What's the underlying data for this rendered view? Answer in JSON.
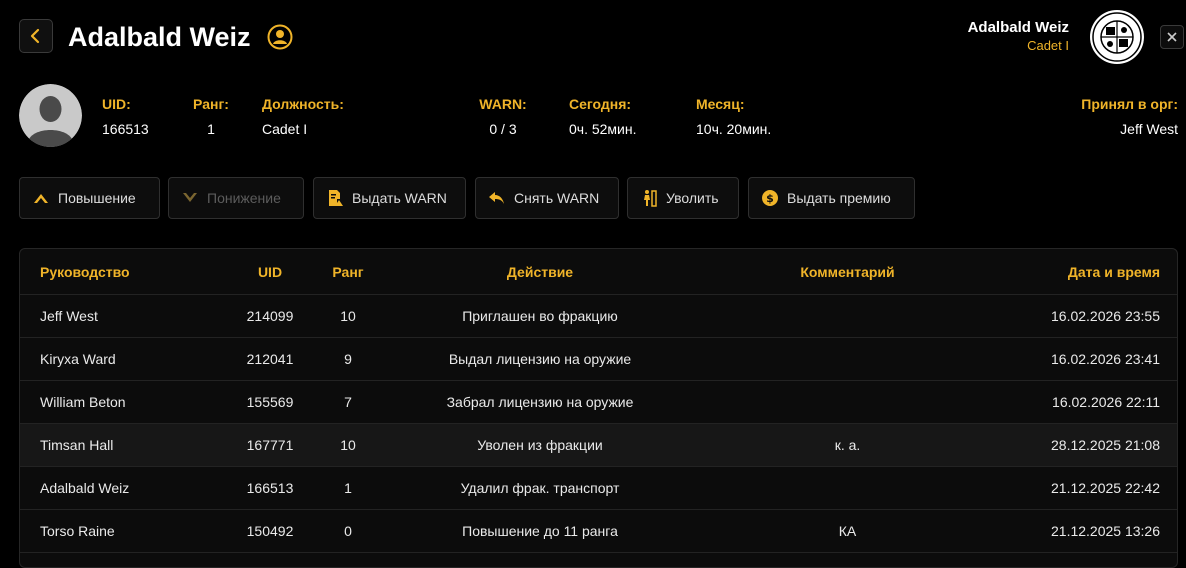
{
  "header": {
    "title": "Adalbald Weiz",
    "top_user_name": "Adalbald Weiz",
    "top_user_rank": "Cadet I",
    "accent_color": "#f0b429"
  },
  "profile": {
    "stats": [
      {
        "label": "UID:",
        "value": "166513"
      },
      {
        "label": "Ранг:",
        "value": "1"
      },
      {
        "label": "Должность:",
        "value": "Cadet I"
      },
      {
        "label": "WARN:",
        "value": "0 / 3"
      },
      {
        "label": "Сегодня:",
        "value": "0ч. 52мин."
      },
      {
        "label": "Месяц:",
        "value": "10ч. 20мин."
      },
      {
        "label": "Принял в орг:",
        "value": "Jeff West"
      }
    ]
  },
  "actions": [
    {
      "label": "Повышение",
      "icon": "chevron-up-icon",
      "enabled": true
    },
    {
      "label": "Понижение",
      "icon": "chevron-down-icon",
      "enabled": false
    },
    {
      "label": "Выдать WARN",
      "icon": "warn-document-icon",
      "enabled": true
    },
    {
      "label": "Снять WARN",
      "icon": "undo-arrow-icon",
      "enabled": true
    },
    {
      "label": "Уволить",
      "icon": "exit-person-icon",
      "enabled": true
    },
    {
      "label": "Выдать премию",
      "icon": "dollar-coin-icon",
      "enabled": true
    }
  ],
  "table": {
    "columns": [
      "Руководство",
      "UID",
      "Ранг",
      "Действие",
      "Комментарий",
      "Дата и время"
    ],
    "rows": [
      {
        "leader": "Jeff West",
        "uid": "214099",
        "rank": "10",
        "action": "Приглашен во фракцию",
        "comment": "",
        "datetime": "16.02.2026 23:55"
      },
      {
        "leader": "Kiryxa Ward",
        "uid": "212041",
        "rank": "9",
        "action": "Выдал лицензию на оружие",
        "comment": "",
        "datetime": "16.02.2026 23:41"
      },
      {
        "leader": "William Beton",
        "uid": "155569",
        "rank": "7",
        "action": "Забрал лицензию на оружие",
        "comment": "",
        "datetime": "16.02.2026 22:11"
      },
      {
        "leader": "Timsan Hall",
        "uid": "167771",
        "rank": "10",
        "action": "Уволен из фракции",
        "comment": "к. а.",
        "datetime": "28.12.2025 21:08"
      },
      {
        "leader": "Adalbald Weiz",
        "uid": "166513",
        "rank": "1",
        "action": "Удалил фрак. транспорт",
        "comment": "",
        "datetime": "21.12.2025 22:42"
      },
      {
        "leader": "Torso Raine",
        "uid": "150492",
        "rank": "0",
        "action": "Повышение до 11 ранга",
        "comment": "КА",
        "datetime": "21.12.2025 13:26"
      },
      {
        "leader": "",
        "uid": "",
        "rank": "",
        "action": "",
        "comment": "",
        "datetime": ""
      }
    ]
  }
}
